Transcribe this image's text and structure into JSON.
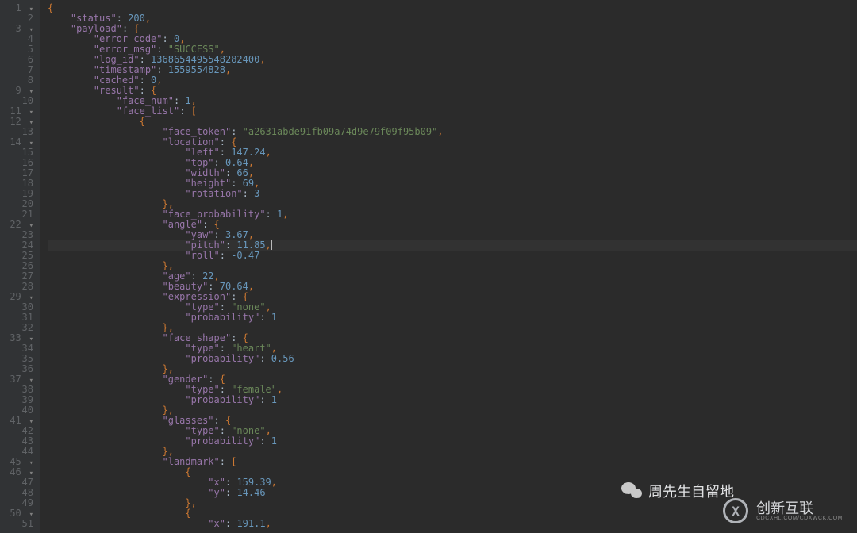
{
  "editor": {
    "highlighted_line": 24,
    "lines": [
      {
        "n": 1,
        "fold": "▾",
        "tokens": [
          {
            "t": "punc",
            "v": "{"
          }
        ]
      },
      {
        "n": 2,
        "tokens": [
          {
            "t": "plain",
            "v": "    "
          },
          {
            "t": "key",
            "v": "\"status\""
          },
          {
            "t": "plain",
            "v": ": "
          },
          {
            "t": "num",
            "v": "200"
          },
          {
            "t": "punc",
            "v": ","
          }
        ]
      },
      {
        "n": 3,
        "fold": "▾",
        "tokens": [
          {
            "t": "plain",
            "v": "    "
          },
          {
            "t": "key",
            "v": "\"payload\""
          },
          {
            "t": "plain",
            "v": ": "
          },
          {
            "t": "punc",
            "v": "{"
          }
        ]
      },
      {
        "n": 4,
        "tokens": [
          {
            "t": "plain",
            "v": "        "
          },
          {
            "t": "key",
            "v": "\"error_code\""
          },
          {
            "t": "plain",
            "v": ": "
          },
          {
            "t": "num",
            "v": "0"
          },
          {
            "t": "punc",
            "v": ","
          }
        ]
      },
      {
        "n": 5,
        "tokens": [
          {
            "t": "plain",
            "v": "        "
          },
          {
            "t": "key",
            "v": "\"error_msg\""
          },
          {
            "t": "plain",
            "v": ": "
          },
          {
            "t": "str",
            "v": "\"SUCCESS\""
          },
          {
            "t": "punc",
            "v": ","
          }
        ]
      },
      {
        "n": 6,
        "tokens": [
          {
            "t": "plain",
            "v": "        "
          },
          {
            "t": "key",
            "v": "\"log_id\""
          },
          {
            "t": "plain",
            "v": ": "
          },
          {
            "t": "num",
            "v": "1368654495548282400"
          },
          {
            "t": "punc",
            "v": ","
          }
        ]
      },
      {
        "n": 7,
        "tokens": [
          {
            "t": "plain",
            "v": "        "
          },
          {
            "t": "key",
            "v": "\"timestamp\""
          },
          {
            "t": "plain",
            "v": ": "
          },
          {
            "t": "num",
            "v": "1559554828"
          },
          {
            "t": "punc",
            "v": ","
          }
        ]
      },
      {
        "n": 8,
        "tokens": [
          {
            "t": "plain",
            "v": "        "
          },
          {
            "t": "key",
            "v": "\"cached\""
          },
          {
            "t": "plain",
            "v": ": "
          },
          {
            "t": "num",
            "v": "0"
          },
          {
            "t": "punc",
            "v": ","
          }
        ]
      },
      {
        "n": 9,
        "fold": "▾",
        "tokens": [
          {
            "t": "plain",
            "v": "        "
          },
          {
            "t": "key",
            "v": "\"result\""
          },
          {
            "t": "plain",
            "v": ": "
          },
          {
            "t": "punc",
            "v": "{"
          }
        ]
      },
      {
        "n": 10,
        "tokens": [
          {
            "t": "plain",
            "v": "            "
          },
          {
            "t": "key",
            "v": "\"face_num\""
          },
          {
            "t": "plain",
            "v": ": "
          },
          {
            "t": "num",
            "v": "1"
          },
          {
            "t": "punc",
            "v": ","
          }
        ]
      },
      {
        "n": 11,
        "fold": "▾",
        "tokens": [
          {
            "t": "plain",
            "v": "            "
          },
          {
            "t": "key",
            "v": "\"face_list\""
          },
          {
            "t": "plain",
            "v": ": "
          },
          {
            "t": "punc",
            "v": "["
          }
        ]
      },
      {
        "n": 12,
        "fold": "▾",
        "tokens": [
          {
            "t": "plain",
            "v": "                "
          },
          {
            "t": "punc",
            "v": "{"
          }
        ]
      },
      {
        "n": 13,
        "tokens": [
          {
            "t": "plain",
            "v": "                    "
          },
          {
            "t": "key",
            "v": "\"face_token\""
          },
          {
            "t": "plain",
            "v": ": "
          },
          {
            "t": "str",
            "v": "\"a2631abde91fb09a74d9e79f09f95b09\""
          },
          {
            "t": "punc",
            "v": ","
          }
        ]
      },
      {
        "n": 14,
        "fold": "▾",
        "tokens": [
          {
            "t": "plain",
            "v": "                    "
          },
          {
            "t": "key",
            "v": "\"location\""
          },
          {
            "t": "plain",
            "v": ": "
          },
          {
            "t": "punc",
            "v": "{"
          }
        ]
      },
      {
        "n": 15,
        "tokens": [
          {
            "t": "plain",
            "v": "                        "
          },
          {
            "t": "key",
            "v": "\"left\""
          },
          {
            "t": "plain",
            "v": ": "
          },
          {
            "t": "num",
            "v": "147.24"
          },
          {
            "t": "punc",
            "v": ","
          }
        ]
      },
      {
        "n": 16,
        "tokens": [
          {
            "t": "plain",
            "v": "                        "
          },
          {
            "t": "key",
            "v": "\"top\""
          },
          {
            "t": "plain",
            "v": ": "
          },
          {
            "t": "num",
            "v": "0.64"
          },
          {
            "t": "punc",
            "v": ","
          }
        ]
      },
      {
        "n": 17,
        "tokens": [
          {
            "t": "plain",
            "v": "                        "
          },
          {
            "t": "key",
            "v": "\"width\""
          },
          {
            "t": "plain",
            "v": ": "
          },
          {
            "t": "num",
            "v": "66"
          },
          {
            "t": "punc",
            "v": ","
          }
        ]
      },
      {
        "n": 18,
        "tokens": [
          {
            "t": "plain",
            "v": "                        "
          },
          {
            "t": "key",
            "v": "\"height\""
          },
          {
            "t": "plain",
            "v": ": "
          },
          {
            "t": "num",
            "v": "69"
          },
          {
            "t": "punc",
            "v": ","
          }
        ]
      },
      {
        "n": 19,
        "tokens": [
          {
            "t": "plain",
            "v": "                        "
          },
          {
            "t": "key",
            "v": "\"rotation\""
          },
          {
            "t": "plain",
            "v": ": "
          },
          {
            "t": "num",
            "v": "3"
          }
        ]
      },
      {
        "n": 20,
        "tokens": [
          {
            "t": "plain",
            "v": "                    "
          },
          {
            "t": "punc",
            "v": "},"
          }
        ]
      },
      {
        "n": 21,
        "tokens": [
          {
            "t": "plain",
            "v": "                    "
          },
          {
            "t": "key",
            "v": "\"face_probability\""
          },
          {
            "t": "plain",
            "v": ": "
          },
          {
            "t": "num",
            "v": "1"
          },
          {
            "t": "punc",
            "v": ","
          }
        ]
      },
      {
        "n": 22,
        "fold": "▾",
        "tokens": [
          {
            "t": "plain",
            "v": "                    "
          },
          {
            "t": "key",
            "v": "\"angle\""
          },
          {
            "t": "plain",
            "v": ": "
          },
          {
            "t": "punc",
            "v": "{"
          }
        ]
      },
      {
        "n": 23,
        "tokens": [
          {
            "t": "plain",
            "v": "                        "
          },
          {
            "t": "key",
            "v": "\"yaw\""
          },
          {
            "t": "plain",
            "v": ": "
          },
          {
            "t": "num",
            "v": "3.67"
          },
          {
            "t": "punc",
            "v": ","
          }
        ]
      },
      {
        "n": 24,
        "tokens": [
          {
            "t": "plain",
            "v": "                        "
          },
          {
            "t": "key",
            "v": "\"pitch\""
          },
          {
            "t": "plain",
            "v": ": "
          },
          {
            "t": "num",
            "v": "11.85"
          },
          {
            "t": "punc",
            "v": ","
          },
          {
            "t": "caret",
            "v": ""
          }
        ]
      },
      {
        "n": 25,
        "tokens": [
          {
            "t": "plain",
            "v": "                        "
          },
          {
            "t": "key",
            "v": "\"roll\""
          },
          {
            "t": "plain",
            "v": ": "
          },
          {
            "t": "num",
            "v": "-0.47"
          }
        ]
      },
      {
        "n": 26,
        "tokens": [
          {
            "t": "plain",
            "v": "                    "
          },
          {
            "t": "punc",
            "v": "},"
          }
        ]
      },
      {
        "n": 27,
        "tokens": [
          {
            "t": "plain",
            "v": "                    "
          },
          {
            "t": "key",
            "v": "\"age\""
          },
          {
            "t": "plain",
            "v": ": "
          },
          {
            "t": "num",
            "v": "22"
          },
          {
            "t": "punc",
            "v": ","
          }
        ]
      },
      {
        "n": 28,
        "tokens": [
          {
            "t": "plain",
            "v": "                    "
          },
          {
            "t": "key",
            "v": "\"beauty\""
          },
          {
            "t": "plain",
            "v": ": "
          },
          {
            "t": "num",
            "v": "70.64"
          },
          {
            "t": "punc",
            "v": ","
          }
        ]
      },
      {
        "n": 29,
        "fold": "▾",
        "tokens": [
          {
            "t": "plain",
            "v": "                    "
          },
          {
            "t": "key",
            "v": "\"expression\""
          },
          {
            "t": "plain",
            "v": ": "
          },
          {
            "t": "punc",
            "v": "{"
          }
        ]
      },
      {
        "n": 30,
        "tokens": [
          {
            "t": "plain",
            "v": "                        "
          },
          {
            "t": "key",
            "v": "\"type\""
          },
          {
            "t": "plain",
            "v": ": "
          },
          {
            "t": "str",
            "v": "\"none\""
          },
          {
            "t": "punc",
            "v": ","
          }
        ]
      },
      {
        "n": 31,
        "tokens": [
          {
            "t": "plain",
            "v": "                        "
          },
          {
            "t": "key",
            "v": "\"probability\""
          },
          {
            "t": "plain",
            "v": ": "
          },
          {
            "t": "num",
            "v": "1"
          }
        ]
      },
      {
        "n": 32,
        "tokens": [
          {
            "t": "plain",
            "v": "                    "
          },
          {
            "t": "punc",
            "v": "},"
          }
        ]
      },
      {
        "n": 33,
        "fold": "▾",
        "tokens": [
          {
            "t": "plain",
            "v": "                    "
          },
          {
            "t": "key",
            "v": "\"face_shape\""
          },
          {
            "t": "plain",
            "v": ": "
          },
          {
            "t": "punc",
            "v": "{"
          }
        ]
      },
      {
        "n": 34,
        "tokens": [
          {
            "t": "plain",
            "v": "                        "
          },
          {
            "t": "key",
            "v": "\"type\""
          },
          {
            "t": "plain",
            "v": ": "
          },
          {
            "t": "str",
            "v": "\"heart\""
          },
          {
            "t": "punc",
            "v": ","
          }
        ]
      },
      {
        "n": 35,
        "tokens": [
          {
            "t": "plain",
            "v": "                        "
          },
          {
            "t": "key",
            "v": "\"probability\""
          },
          {
            "t": "plain",
            "v": ": "
          },
          {
            "t": "num",
            "v": "0.56"
          }
        ]
      },
      {
        "n": 36,
        "tokens": [
          {
            "t": "plain",
            "v": "                    "
          },
          {
            "t": "punc",
            "v": "},"
          }
        ]
      },
      {
        "n": 37,
        "fold": "▾",
        "tokens": [
          {
            "t": "plain",
            "v": "                    "
          },
          {
            "t": "key",
            "v": "\"gender\""
          },
          {
            "t": "plain",
            "v": ": "
          },
          {
            "t": "punc",
            "v": "{"
          }
        ]
      },
      {
        "n": 38,
        "tokens": [
          {
            "t": "plain",
            "v": "                        "
          },
          {
            "t": "key",
            "v": "\"type\""
          },
          {
            "t": "plain",
            "v": ": "
          },
          {
            "t": "str",
            "v": "\"female\""
          },
          {
            "t": "punc",
            "v": ","
          }
        ]
      },
      {
        "n": 39,
        "tokens": [
          {
            "t": "plain",
            "v": "                        "
          },
          {
            "t": "key",
            "v": "\"probability\""
          },
          {
            "t": "plain",
            "v": ": "
          },
          {
            "t": "num",
            "v": "1"
          }
        ]
      },
      {
        "n": 40,
        "tokens": [
          {
            "t": "plain",
            "v": "                    "
          },
          {
            "t": "punc",
            "v": "},"
          }
        ]
      },
      {
        "n": 41,
        "fold": "▾",
        "tokens": [
          {
            "t": "plain",
            "v": "                    "
          },
          {
            "t": "key",
            "v": "\"glasses\""
          },
          {
            "t": "plain",
            "v": ": "
          },
          {
            "t": "punc",
            "v": "{"
          }
        ]
      },
      {
        "n": 42,
        "tokens": [
          {
            "t": "plain",
            "v": "                        "
          },
          {
            "t": "key",
            "v": "\"type\""
          },
          {
            "t": "plain",
            "v": ": "
          },
          {
            "t": "str",
            "v": "\"none\""
          },
          {
            "t": "punc",
            "v": ","
          }
        ]
      },
      {
        "n": 43,
        "tokens": [
          {
            "t": "plain",
            "v": "                        "
          },
          {
            "t": "key",
            "v": "\"probability\""
          },
          {
            "t": "plain",
            "v": ": "
          },
          {
            "t": "num",
            "v": "1"
          }
        ]
      },
      {
        "n": 44,
        "tokens": [
          {
            "t": "plain",
            "v": "                    "
          },
          {
            "t": "punc",
            "v": "},"
          }
        ]
      },
      {
        "n": 45,
        "fold": "▾",
        "tokens": [
          {
            "t": "plain",
            "v": "                    "
          },
          {
            "t": "key",
            "v": "\"landmark\""
          },
          {
            "t": "plain",
            "v": ": "
          },
          {
            "t": "punc",
            "v": "["
          }
        ]
      },
      {
        "n": 46,
        "fold": "▾",
        "tokens": [
          {
            "t": "plain",
            "v": "                        "
          },
          {
            "t": "punc",
            "v": "{"
          }
        ]
      },
      {
        "n": 47,
        "tokens": [
          {
            "t": "plain",
            "v": "                            "
          },
          {
            "t": "key",
            "v": "\"x\""
          },
          {
            "t": "plain",
            "v": ": "
          },
          {
            "t": "num",
            "v": "159.39"
          },
          {
            "t": "punc",
            "v": ","
          }
        ]
      },
      {
        "n": 48,
        "tokens": [
          {
            "t": "plain",
            "v": "                            "
          },
          {
            "t": "key",
            "v": "\"y\""
          },
          {
            "t": "plain",
            "v": ": "
          },
          {
            "t": "num",
            "v": "14.46"
          }
        ]
      },
      {
        "n": 49,
        "tokens": [
          {
            "t": "plain",
            "v": "                        "
          },
          {
            "t": "punc",
            "v": "},"
          }
        ]
      },
      {
        "n": 50,
        "fold": "▾",
        "tokens": [
          {
            "t": "plain",
            "v": "                        "
          },
          {
            "t": "punc",
            "v": "{"
          }
        ]
      },
      {
        "n": 51,
        "tokens": [
          {
            "t": "plain",
            "v": "                            "
          },
          {
            "t": "key",
            "v": "\"x\""
          },
          {
            "t": "plain",
            "v": ": "
          },
          {
            "t": "num",
            "v": "191.1"
          },
          {
            "t": "punc",
            "v": ","
          }
        ]
      }
    ]
  },
  "watermark": {
    "wechat_label": "周先生自留地",
    "brand": "创新互联",
    "brand_sub": "CDCXHL.COM/CDXWCK.COM",
    "badge": "X"
  }
}
